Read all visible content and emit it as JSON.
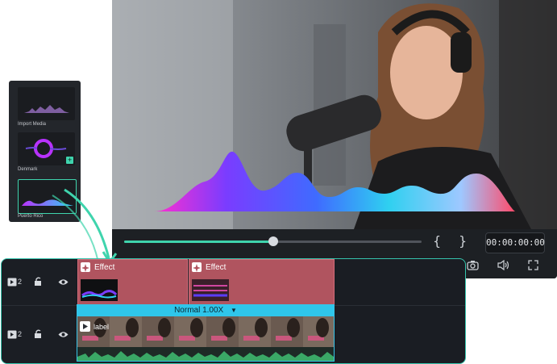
{
  "media_panel": {
    "items": [
      {
        "label": "Import Media"
      },
      {
        "label": "Denmark"
      },
      {
        "label": "Puerto Rico"
      }
    ]
  },
  "player": {
    "timecode": "00:00:00:00",
    "progress": 0.5,
    "mark_in": "{",
    "mark_out": "}"
  },
  "timeline": {
    "tracks": [
      {
        "number": "2",
        "clips": [
          {
            "label": "Effect"
          },
          {
            "label": "Effect"
          }
        ]
      },
      {
        "number": "2",
        "speed_label": "Normal 1.00X",
        "clip_label": "label"
      }
    ]
  },
  "colors": {
    "accent": "#3fd4ad",
    "effect_clip": "#b0545f",
    "video_clip": "#2fc6ea",
    "panel_bg": "#1a1d23"
  },
  "icons": [
    "video-track-icon",
    "lock-icon",
    "eye-icon",
    "camera-icon",
    "volume-icon",
    "fullscreen-icon",
    "play-icon",
    "sparkle-icon",
    "plus-icon"
  ]
}
